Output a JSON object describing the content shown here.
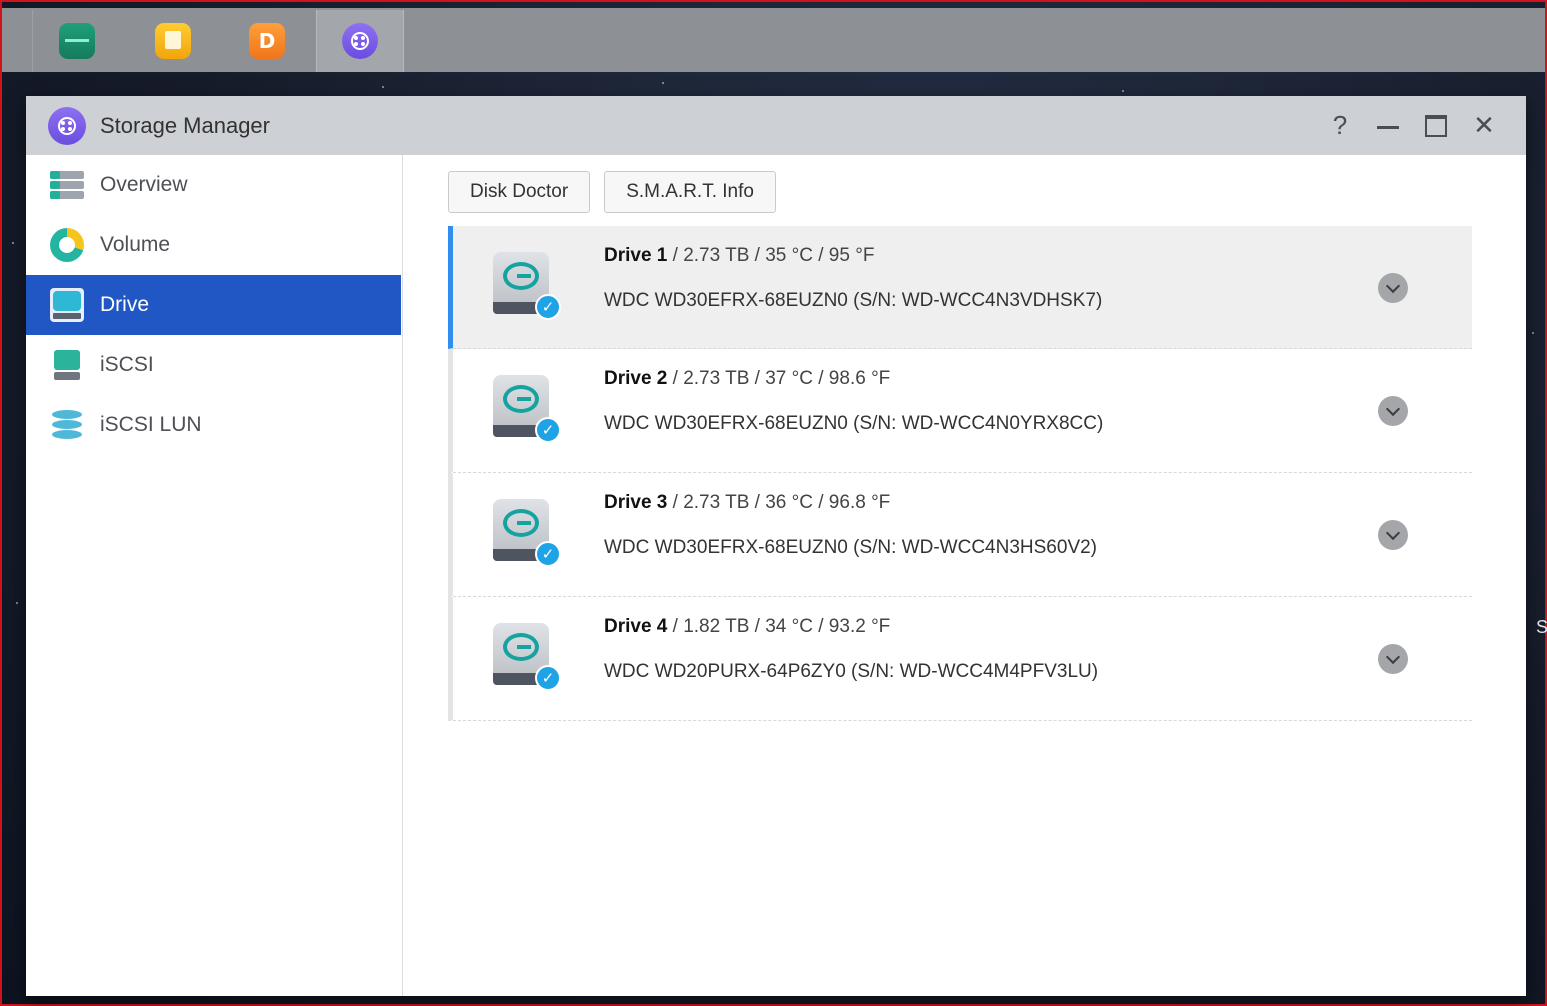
{
  "taskbar": {
    "apps": [
      {
        "icon": "resource-monitor-icon"
      },
      {
        "icon": "file-station-icon"
      },
      {
        "icon": "download-center-icon",
        "glyph": "D"
      },
      {
        "icon": "storage-manager-icon",
        "active": true
      }
    ]
  },
  "edge_text": "S",
  "window": {
    "title": "Storage Manager",
    "controls": {
      "help": "?",
      "close": "✕"
    }
  },
  "sidebar": {
    "items": [
      {
        "label": "Overview",
        "icon": "overview-icon"
      },
      {
        "label": "Volume",
        "icon": "volume-icon"
      },
      {
        "label": "Drive",
        "icon": "drive-icon",
        "active": true
      },
      {
        "label": "iSCSI",
        "icon": "iscsi-icon"
      },
      {
        "label": "iSCSI LUN",
        "icon": "iscsi-lun-icon"
      }
    ]
  },
  "toolbar": {
    "disk_doctor": "Disk Doctor",
    "smart_info": "S.M.A.R.T. Info"
  },
  "drives": [
    {
      "name": "Drive 1",
      "details": " / 2.73 TB / 35 °C / 95 °F",
      "model": "WDC WD30EFRX-68EUZN0 (S/N: WD-WCC4N3VDHSK7)",
      "selected": true,
      "status": "healthy"
    },
    {
      "name": "Drive 2",
      "details": " / 2.73 TB / 37 °C / 98.6 °F",
      "model": "WDC WD30EFRX-68EUZN0 (S/N: WD-WCC4N0YRX8CC)",
      "selected": false,
      "status": "healthy"
    },
    {
      "name": "Drive 3",
      "details": " / 2.73 TB / 36 °C / 96.8 °F",
      "model": "WDC WD30EFRX-68EUZN0 (S/N: WD-WCC4N3HS60V2)",
      "selected": false,
      "status": "healthy"
    },
    {
      "name": "Drive 4",
      "details": " / 1.82 TB / 34 °C / 93.2 °F",
      "model": "WDC WD20PURX-64P6ZY0 (S/N: WD-WCC4M4PFV3LU)",
      "selected": false,
      "status": "healthy"
    }
  ],
  "colors": {
    "accent": "#2157c4",
    "selected_border": "#2f8ef0",
    "status_check": "#1ea3e6",
    "frame_border": "#d0141c"
  }
}
